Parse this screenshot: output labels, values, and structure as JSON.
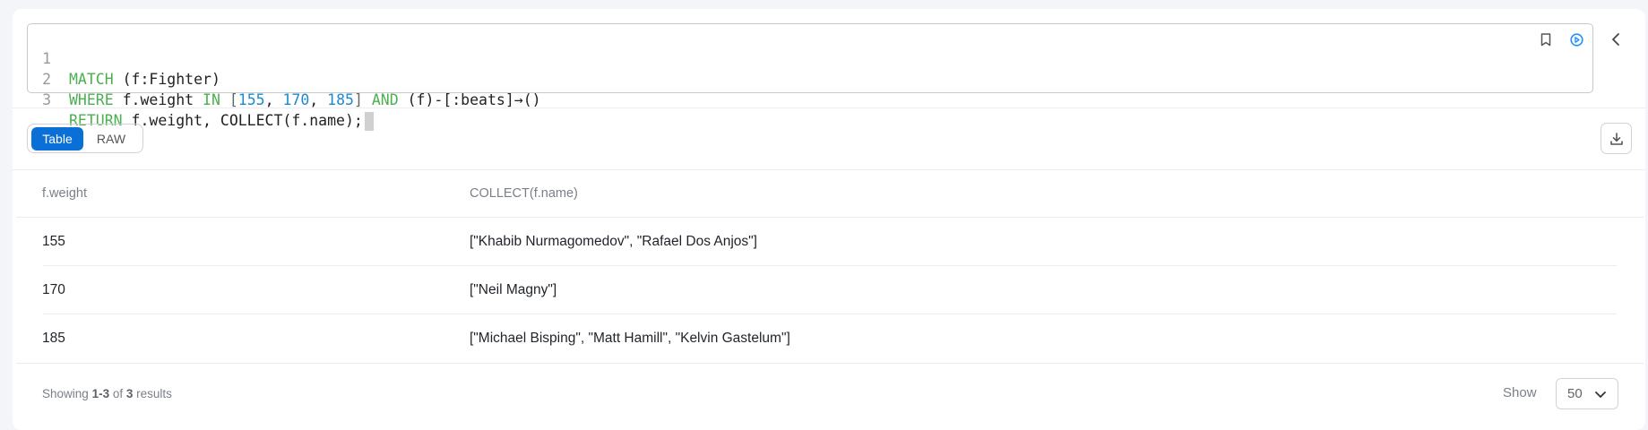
{
  "editor": {
    "lines": [
      {
        "number": "1",
        "tokens": [
          {
            "t": "MATCH",
            "c": "kw"
          },
          {
            "t": " (f:Fighter)",
            "c": ""
          }
        ]
      },
      {
        "number": "2",
        "tokens": [
          {
            "t": "WHERE",
            "c": "kw"
          },
          {
            "t": " f.weight ",
            "c": ""
          },
          {
            "t": "IN",
            "c": "kw"
          },
          {
            "t": " [",
            "c": "op"
          },
          {
            "t": "155",
            "c": "num"
          },
          {
            "t": ", ",
            "c": ""
          },
          {
            "t": "170",
            "c": "num"
          },
          {
            "t": ", ",
            "c": ""
          },
          {
            "t": "185",
            "c": "num"
          },
          {
            "t": "] ",
            "c": "op"
          },
          {
            "t": "AND",
            "c": "kw"
          },
          {
            "t": " (f)-[:beats]→()",
            "c": ""
          }
        ]
      },
      {
        "number": "3",
        "tokens": [
          {
            "t": "RETURN",
            "c": "kw"
          },
          {
            "t": " f.weight, COLLECT(f.name);",
            "c": ""
          }
        ]
      }
    ],
    "icons": {
      "bookmark": "bookmark-icon",
      "run": "play-circle-icon",
      "collapse": "chevron-left-icon"
    }
  },
  "view_toggle": {
    "options": [
      "Table",
      "RAW"
    ],
    "selected": "Table"
  },
  "download_icon": "download-icon",
  "table": {
    "columns": [
      "f.weight",
      "COLLECT(f.name)"
    ],
    "rows": [
      [
        "155",
        "[\"Khabib Nurmagomedov\", \"Rafael Dos Anjos\"]"
      ],
      [
        "170",
        "[\"Neil Magny\"]"
      ],
      [
        "185",
        "[\"Michael Bisping\", \"Matt Hamill\", \"Kelvin Gastelum\"]"
      ]
    ]
  },
  "footer": {
    "showing_prefix": "Showing",
    "range": "1-3",
    "of": "of",
    "total": "3",
    "suffix": "results",
    "show_label": "Show",
    "page_size": "50"
  },
  "colors": {
    "accent": "#0a6fd6",
    "keyword": "#4caf50",
    "number": "#1b8ad3",
    "run_icon": "#1e90ff"
  }
}
